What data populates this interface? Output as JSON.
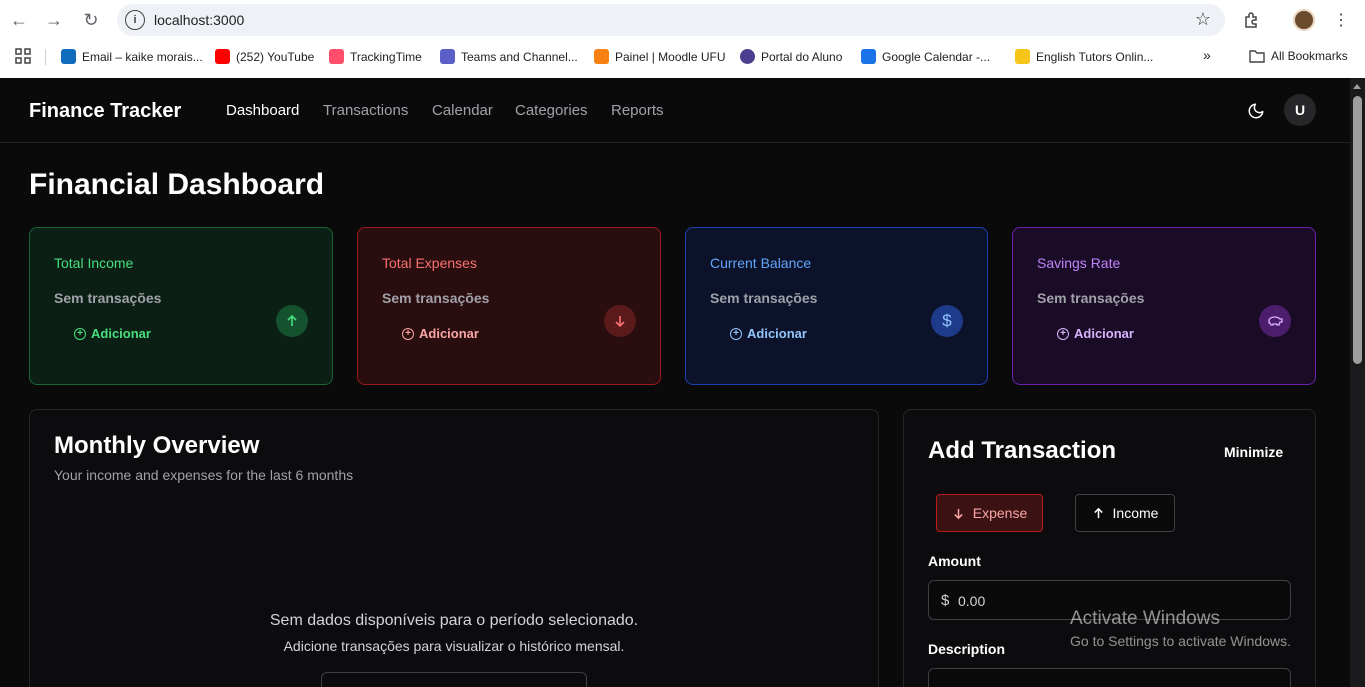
{
  "browser": {
    "url": "localhost:3000",
    "bookmarks": [
      {
        "label": "Email – kaike morais...",
        "color": "#0f6cbd"
      },
      {
        "label": "(252) YouTube",
        "color": "#ff0000"
      },
      {
        "label": "TrackingTime",
        "color": "#ff4f6d"
      },
      {
        "label": "Teams and Channel...",
        "color": "#5b5fc7"
      },
      {
        "label": "Painel | Moodle UFU",
        "color": "#f98012"
      },
      {
        "label": "Portal do Aluno",
        "color": "#4b3f8f"
      },
      {
        "label": "Google Calendar -...",
        "color": "#1a73e8"
      },
      {
        "label": "English Tutors Onlin...",
        "color": "#f5c518"
      }
    ],
    "more_bookmarks": "»",
    "all_bookmarks": "All Bookmarks"
  },
  "header": {
    "brand": "Finance Tracker",
    "nav": [
      "Dashboard",
      "Transactions",
      "Calendar",
      "Categories",
      "Reports"
    ],
    "active_nav": "Dashboard",
    "user_initial": "U"
  },
  "page_title": "Financial Dashboard",
  "cards": [
    {
      "title": "Total Income",
      "empty": "Sem transações",
      "add": "Adicionar",
      "icon": "arrow-up-icon",
      "accent": "#4ade80"
    },
    {
      "title": "Total Expenses",
      "empty": "Sem transações",
      "add": "Adicionar",
      "icon": "arrow-down-icon",
      "accent": "#f87171"
    },
    {
      "title": "Current Balance",
      "empty": "Sem transações",
      "add": "Adicionar",
      "icon": "dollar-icon",
      "accent": "#60a5fa"
    },
    {
      "title": "Savings Rate",
      "empty": "Sem transações",
      "add": "Adicionar",
      "icon": "piggy-bank-icon",
      "accent": "#c084fc"
    }
  ],
  "overview": {
    "title": "Monthly Overview",
    "subtitle": "Your income and expenses for the last 6 months",
    "empty_title": "Sem dados disponíveis para o período selecionado.",
    "empty_subtitle": "Adicione transações para visualizar o histórico mensal."
  },
  "add_transaction": {
    "title": "Add Transaction",
    "minimize": "Minimize",
    "expense_label": "Expense",
    "income_label": "Income",
    "amount_label": "Amount",
    "currency": "$",
    "amount_value": "0.00",
    "description_label": "Description"
  },
  "watermark": {
    "line1": "Activate Windows",
    "line2": "Go to Settings to activate Windows."
  }
}
